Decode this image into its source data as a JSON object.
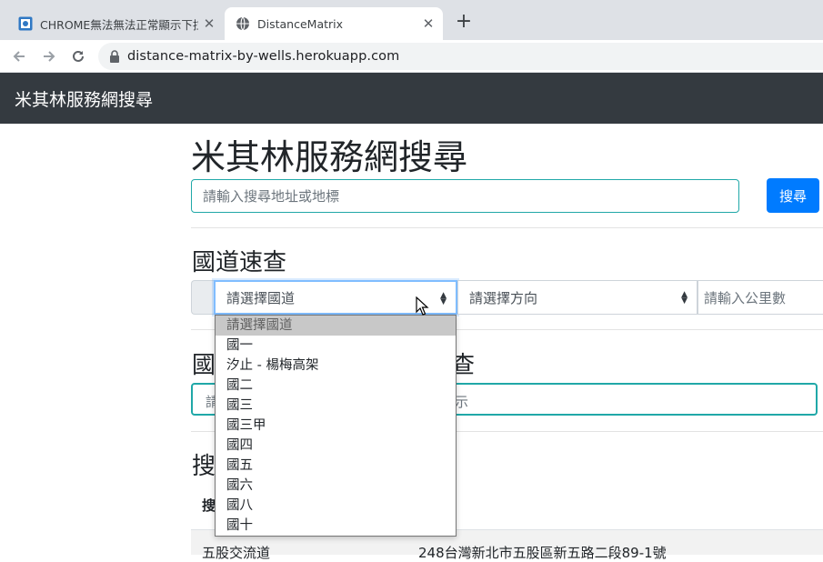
{
  "browser": {
    "tabs": [
      {
        "title": "CHROME無法無法正常顯示下拉",
        "active": false,
        "favicon": "ms-docs-icon"
      },
      {
        "title": "DistanceMatrix",
        "active": true,
        "favicon": "globe-icon"
      }
    ],
    "new_tab_glyph": "+",
    "url": "distance-matrix-by-wells.herokuapp.com"
  },
  "navbar": {
    "brand": "米其林服務網搜尋"
  },
  "main": {
    "title": "米其林服務網搜尋",
    "search": {
      "placeholder": "請輸入搜尋地址或地標",
      "button": "搜尋"
    },
    "highway": {
      "heading": "國道速查",
      "highway_select": "請選擇國道",
      "direction_select": "請選擇方向",
      "km_placeholder": "請輸入公里數",
      "options": [
        "請選擇國道",
        "國一",
        "汐止 - 楊梅高架",
        "國二",
        "國三",
        "國三甲",
        "國四",
        "國五",
        "國六",
        "國八",
        "國十"
      ]
    },
    "section2": {
      "heading_left": "國",
      "heading_right": "查",
      "placeholder_left": "請",
      "placeholder_right": "示"
    },
    "section3": {
      "heading_left": "搜",
      "table_header_left": "搜"
    },
    "result": {
      "name": "五股交流道",
      "address": "248台灣新北市五股區新五路二段89-1號"
    }
  },
  "colors": {
    "navbar": "#343a40",
    "primary": "#007bff",
    "teal_border": "#20a8a8",
    "focus": "#80bdff"
  }
}
